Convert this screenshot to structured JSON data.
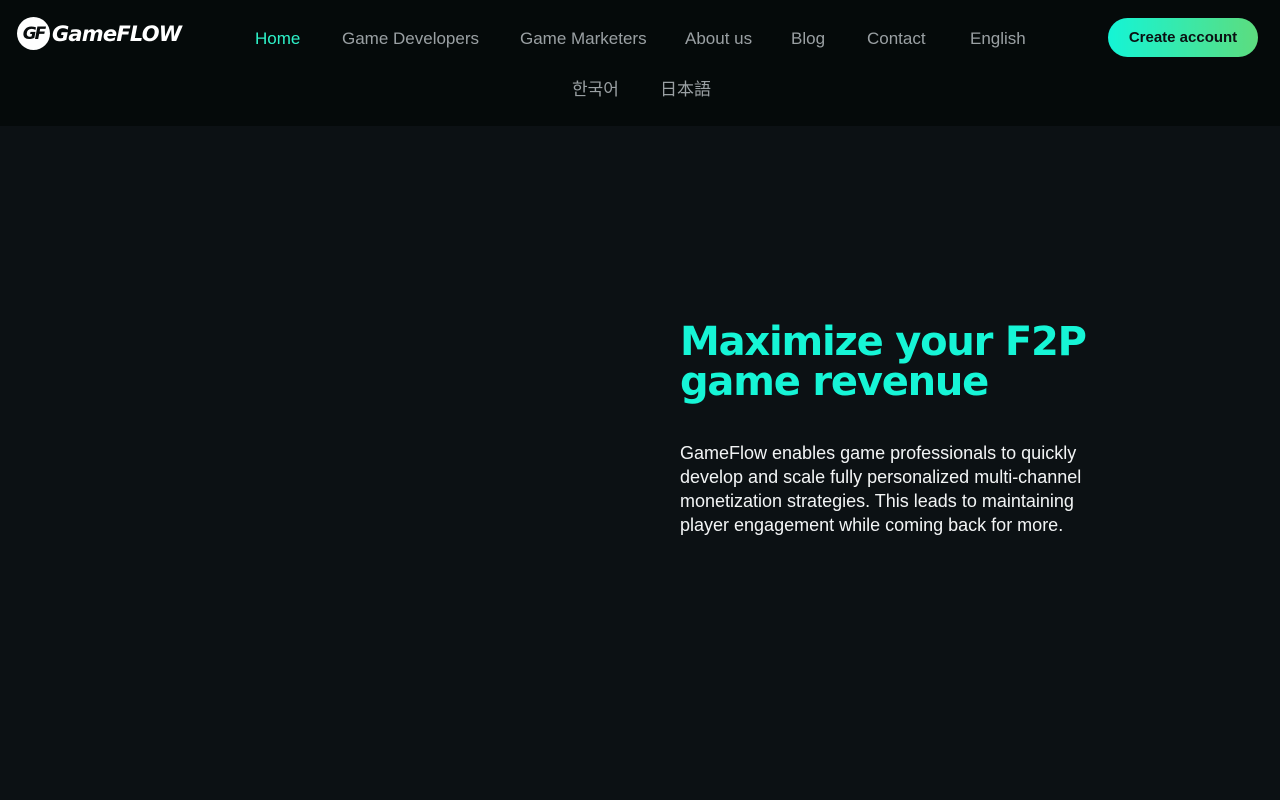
{
  "brand": {
    "logo_mark": "GF",
    "logo_text": "GameFLOW"
  },
  "nav": {
    "items": [
      {
        "label": "Home",
        "active": true
      },
      {
        "label": "Game Developers"
      },
      {
        "label": "Game Marketers"
      },
      {
        "label": "About us"
      },
      {
        "label": "Blog"
      },
      {
        "label": "Contact"
      },
      {
        "label": "English"
      },
      {
        "label": "한국어"
      },
      {
        "label": "日本語"
      }
    ],
    "cta_label": "Create account"
  },
  "hero": {
    "title": "Maximize your F2P game revenue",
    "description": "GameFlow enables game professionals to quickly develop and scale fully personalized multi-channel monetization strategies. This leads to maintaining player engagement while coming back for more."
  },
  "colors": {
    "accent": "#16f5d6",
    "background": "#0c1114",
    "header_background": "#050a0a",
    "nav_text": "#9aa0a3"
  }
}
